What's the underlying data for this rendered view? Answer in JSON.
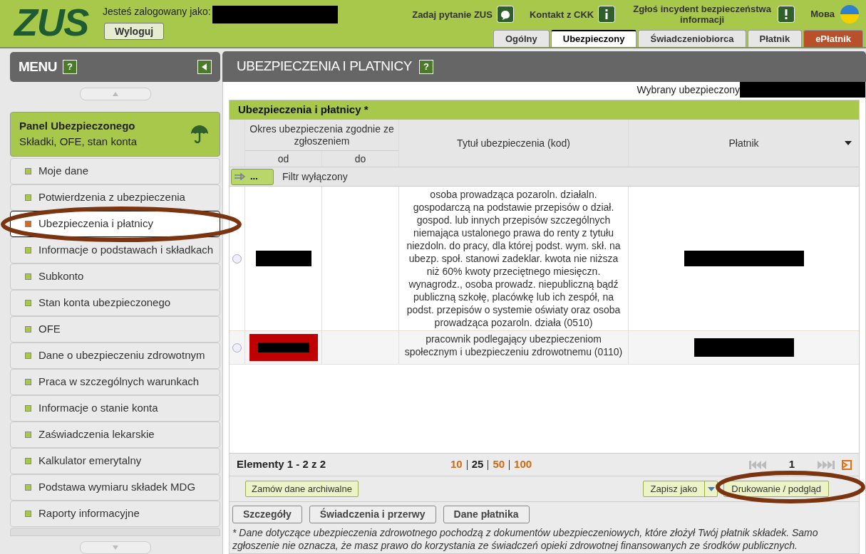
{
  "header": {
    "logo": "ZUS",
    "logged_in_label": "Jesteś zalogowany jako:",
    "logout": "Wyloguj",
    "links": [
      {
        "label": "Zadaj pytanie ZUS",
        "kind": "chat"
      },
      {
        "label": "Kontakt z CKK",
        "kind": "info"
      },
      {
        "label": "Zgłoś incydent bezpieczeństwa informacji",
        "kind": "alert"
      }
    ],
    "language": "Мова",
    "tabs": [
      {
        "label": "Ogólny",
        "selected": false,
        "kind": "normal"
      },
      {
        "label": "Ubezpieczony",
        "selected": true,
        "kind": "normal"
      },
      {
        "label": "Świadczeniobiorca",
        "selected": false,
        "kind": "normal"
      },
      {
        "label": "Płatnik",
        "selected": false,
        "kind": "normal"
      },
      {
        "label": "ePłatnik",
        "selected": false,
        "kind": "accent"
      }
    ]
  },
  "sidebar": {
    "title": "MENU",
    "help": "?",
    "panel": {
      "title": "Panel Ubezpieczonego",
      "subtitle": "Składki, OFE, stan konta"
    },
    "items": [
      {
        "label": "Moje dane",
        "selected": false
      },
      {
        "label": "Potwierdzenia z ubezpieczenia",
        "selected": false
      },
      {
        "label": "Ubezpieczenia i płatnicy",
        "selected": true
      },
      {
        "label": "Informacje o podstawach i składkach",
        "selected": false
      },
      {
        "label": "Subkonto",
        "selected": false
      },
      {
        "label": "Stan konta ubezpieczonego",
        "selected": false
      },
      {
        "label": "OFE",
        "selected": false
      },
      {
        "label": "Dane o ubezpieczeniu zdrowotnym",
        "selected": false
      },
      {
        "label": "Praca w szczególnych warunkach",
        "selected": false
      },
      {
        "label": "Informacje o stanie konta",
        "selected": false
      },
      {
        "label": "Zaświadczenia lekarskie",
        "selected": false
      },
      {
        "label": "Kalkulator emerytalny",
        "selected": false
      },
      {
        "label": "Podstawa wymiaru składek MDG",
        "selected": false
      },
      {
        "label": "Raporty informacyjne",
        "selected": false
      }
    ]
  },
  "main": {
    "title": "UBEZPIECZENIA I PLATNICY",
    "help": "?",
    "selected_insured_label": "Wybrany ubezpieczony",
    "table": {
      "title": "Ubezpieczenia i płatnicy *",
      "period_header": "Okres ubezpieczenia zgodnie ze zgłoszeniem",
      "from_header": "od",
      "to_header": "do",
      "title_header": "Tytuł ubezpieczenia (kod)",
      "payer_header": "Płatnik",
      "filter_button": "...",
      "filter_label": "Filtr wyłączony",
      "rows": [
        {
          "selected": false,
          "flagged": false,
          "title": "osoba prowadząca pozaroln. działaln. gospodarczą na podstawie przepisów o dział. gospod. lub innych przepisów szczególnych niemająca ustalonego prawa do renty z tytułu niezdoln. do pracy, dla której podst. wym. skł. na ubezp. społ. stanowi zadeklar. kwota nie niższa niż 60% kwoty przeciętnego miesięczn. wynagrodz., osoba prowadz. niepubliczną bądź publiczną szkołę, placówkę lub ich zespół, na podst. przepisów o systemie oświaty oraz osoba prowadząca pozaroln. działa (0510)"
        },
        {
          "selected": false,
          "flagged": true,
          "title": "pracownik podlegający ubezpieczeniom społecznym i ubezpieczeniu zdrowotnemu (0110)"
        }
      ]
    },
    "pagination": {
      "summary": "Elementy 1 - 2 z 2",
      "page_sizes": [
        {
          "label": "10",
          "selected": false
        },
        {
          "label": "25",
          "selected": true
        },
        {
          "label": "50",
          "selected": false
        },
        {
          "label": "100",
          "selected": false
        }
      ],
      "page": "1"
    },
    "archive_button": "Zamów dane archiwalne",
    "save_button": "Zapisz jako",
    "print_button": "Drukowanie / podgląd",
    "detail_buttons": [
      "Szczegóły",
      "Świadczenia i przerwy",
      "Dane płatnika"
    ],
    "note": "* Dane dotyczące ubezpieczenia zdrowotnego pochodzą z dokumentów ubezpieczeniowych, które złożył Twój płatnik składek. Samo zgłoszenie nie oznacza, że masz prawo do korzystania ze świadczeń opieki zdrowotnej finansowanych ze środków publicznych."
  }
}
